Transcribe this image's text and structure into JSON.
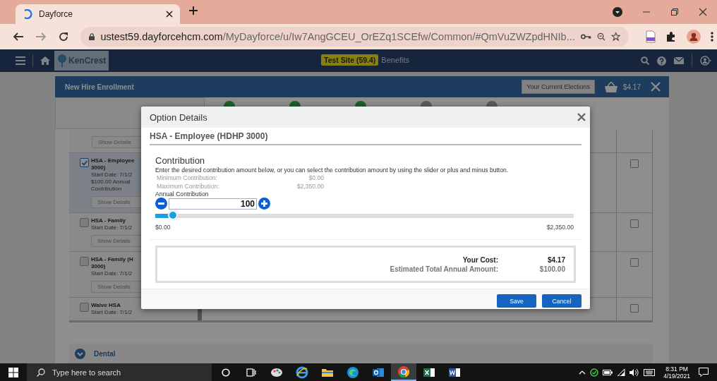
{
  "browser": {
    "tab_title": "Dayforce",
    "url_domain": "ustest59.dayforcehcm.com",
    "url_path": "/MyDayforce/u/Iw7AngGCEU_OrEZq1SCEfw/Common/#QmVuZWZpdHNIb..."
  },
  "app_header": {
    "logo_text": "KenCrest",
    "site_badge": "Test Site (59.4)",
    "page_title": "Benefits"
  },
  "enrollment": {
    "title": "New Hire Enrollment",
    "elections_button": "Your Current Elections",
    "cart_total": "$4.17",
    "steps": [
      {
        "done": true
      },
      {
        "done": true
      },
      {
        "done": true
      },
      {
        "done": false
      },
      {
        "done": false
      }
    ],
    "previous_option_button": "Show Details",
    "options": [
      {
        "name_lines": [
          "HSA - Employee",
          "3000)"
        ],
        "detail_lines": [
          "Start Date: 7/1/2",
          "$100.00 Annual",
          "Contribution"
        ],
        "button": "Show Details",
        "checked": true,
        "selected": true,
        "confirmed": false
      },
      {
        "name_lines": [
          "HSA - Family"
        ],
        "detail_lines": [
          "Start Date: 7/1/2"
        ],
        "button": "Show Details",
        "checked": false,
        "selected": false,
        "confirmed": false
      },
      {
        "name_lines": [
          "HSA - Family (H",
          "3000)"
        ],
        "detail_lines": [
          "Start Date: 7/1/2"
        ],
        "button": "Show Details",
        "checked": false,
        "selected": false,
        "confirmed": false
      },
      {
        "name_lines": [
          "Waive HSA"
        ],
        "detail_lines": [
          "Start Date: 7/1/2"
        ],
        "checked": false,
        "selected": false,
        "confirmed": false
      }
    ],
    "sections": [
      {
        "title": "Dental"
      }
    ]
  },
  "modal": {
    "title": "Option Details",
    "plan": "HSA - Employee (HDHP 3000)",
    "section": "Contribution",
    "instructions": "Enter the desired contribution amount below, or you can select the contribution amount by using the slider or plus and minus button.",
    "limits": [
      {
        "label": "Minimum Contribution:",
        "value": "$0.00"
      },
      {
        "label": "Maximum Contribution:",
        "value": "$2,350.00"
      }
    ],
    "amount_label": "Annual Contribution",
    "amount": "100",
    "slider": {
      "level": 0.043,
      "min_label": "$0.00",
      "max_label": "$2,350.00"
    },
    "summary": [
      {
        "label": "Your Cost:",
        "value": "$4.17",
        "emphasis": true
      },
      {
        "label": "Estimated Total Annual Amount:",
        "value": "$100.00",
        "emphasis": false
      }
    ],
    "buttons": [
      {
        "label": "Save"
      },
      {
        "label": "Cancel"
      }
    ]
  },
  "taskbar": {
    "search_placeholder": "Type here to search",
    "apps": [
      {
        "kind": "paint",
        "selected": false
      },
      {
        "kind": "ie",
        "selected": false
      },
      {
        "kind": "explorer",
        "selected": false
      },
      {
        "kind": "edge",
        "selected": false
      },
      {
        "kind": "outlook",
        "selected": false
      },
      {
        "kind": "chrome",
        "selected": true
      },
      {
        "kind": "excel",
        "selected": false
      },
      {
        "kind": "word",
        "selected": false
      }
    ],
    "time": "8:31 PM",
    "date": "4/19/2021"
  }
}
